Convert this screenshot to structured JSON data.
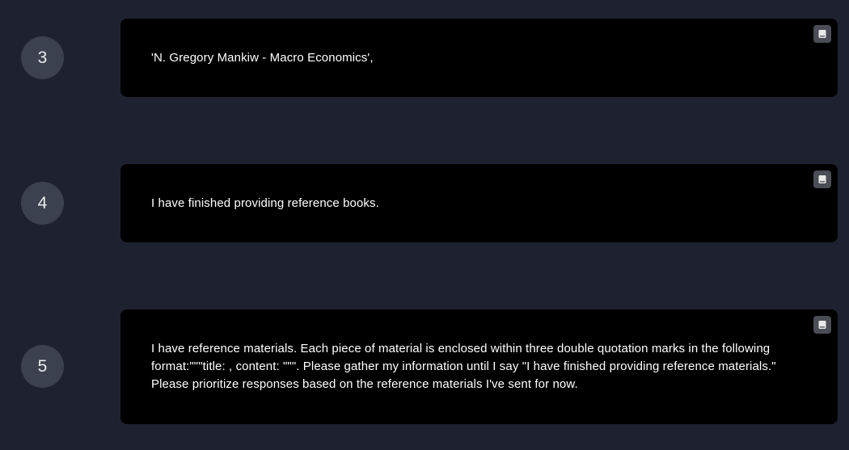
{
  "steps": [
    {
      "number": "3",
      "text": "'N. Gregory Mankiw - Macro Economics',"
    },
    {
      "number": "4",
      "text": "I have finished providing reference books."
    },
    {
      "number": "5",
      "text": "I have reference materials. Each piece of material is enclosed within three double quotation marks in the following format:\"\"\"title: , content: \"\"\". Please gather my information until I say \"I have finished providing reference materials.\" Please prioritize responses based on the reference materials I've sent for now."
    }
  ],
  "icons": {
    "card_action": "book-icon"
  },
  "colors": {
    "background": "#1e2230",
    "card": "#000000",
    "circle": "#3c414f",
    "icon_bg": "#4a4d55"
  }
}
